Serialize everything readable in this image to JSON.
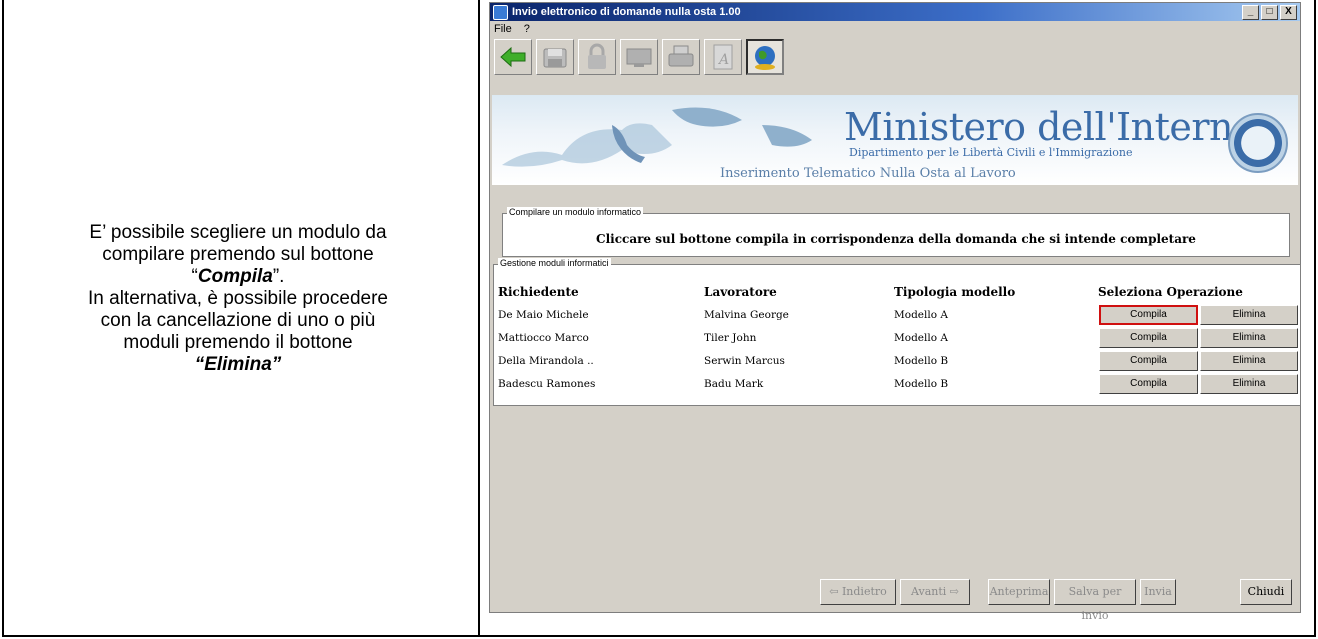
{
  "description": {
    "line1": "E’ possibile scegliere un modulo da",
    "line2": "compilare premendo sul bottone",
    "compila_quote_open": "“",
    "compila_word": "Compila",
    "compila_quote_close": "”.",
    "line4": "In alternativa,  è possibile procedere",
    "line5": "con la cancellazione di uno o più",
    "line6": "moduli premendo il bottone",
    "elimina_quote_open": "“",
    "elimina_word": "Elimina",
    "elimina_quote_close": "”"
  },
  "window": {
    "title": "Invio elettronico di domande nulla osta 1.00",
    "controls": [
      "_",
      "□",
      "X"
    ]
  },
  "menu": [
    "File",
    "?"
  ],
  "toolbar": [
    "back-arrow-icon",
    "floppy-icon",
    "lock-icon",
    "monitor-icon",
    "printer-icon",
    "document-a-icon",
    "globe-icon"
  ],
  "banner": {
    "title": "Ministero dell'Interno",
    "subtitle": "Dipartimento per le Libertà Civili e l'Immigrazione",
    "caption": "Inserimento Telematico Nulla Osta al Lavoro"
  },
  "compile_group": {
    "legend": "Compilare un modulo informatico",
    "message": "Cliccare sul bottone compila in corrispondenza della domanda che si intende completare"
  },
  "manage_group": {
    "legend": "Gestione moduli informatici",
    "headers": [
      "Richiedente",
      "Lavoratore",
      "Tipologia modello",
      "Seleziona Operazione"
    ],
    "rows": [
      {
        "richiedente": "De Maio Michele",
        "lavoratore": "Malvina George",
        "tipologia": "Modello A",
        "compila": "Compila",
        "elimina": "Elimina"
      },
      {
        "richiedente": "Mattiocco Marco",
        "lavoratore": "Tiler John",
        "tipologia": "Modello A",
        "compila": "Compila",
        "elimina": "Elimina"
      },
      {
        "richiedente": "Della Mirandola ..",
        "lavoratore": "Serwin Marcus",
        "tipologia": "Modello B",
        "compila": "Compila",
        "elimina": "Elimina"
      },
      {
        "richiedente": "Badescu Ramones",
        "lavoratore": "Badu Mark",
        "tipologia": "Modello B",
        "compila": "Compila",
        "elimina": "Elimina"
      }
    ]
  },
  "bottom_buttons": {
    "indietro": "Indietro",
    "avanti": "Avanti",
    "anteprima": "Anteprima",
    "salva": "Salva per invio",
    "invia": "Invia",
    "chiudi": "Chiudi"
  },
  "colors": {
    "title_bar": "#0a246a",
    "highlight": "#d01010",
    "banner_text": "#3b6ca8"
  }
}
